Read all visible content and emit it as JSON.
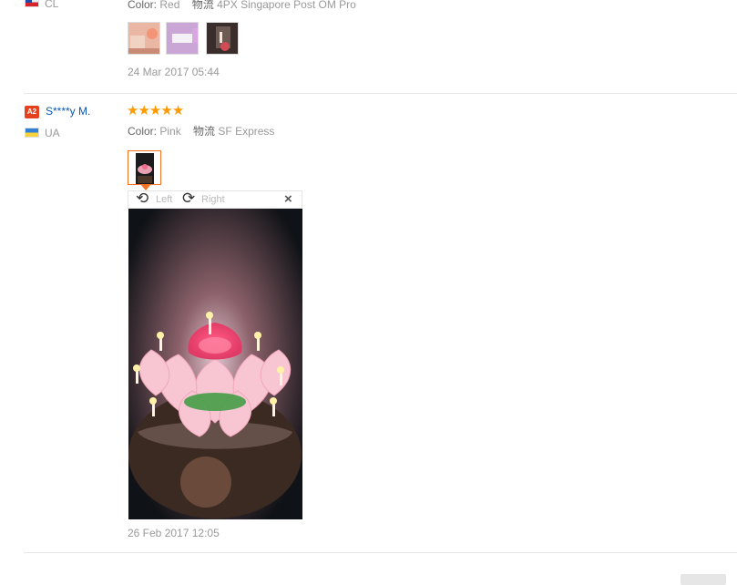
{
  "review_prev": {
    "country": "CL",
    "color_label": "Color:",
    "color_value": "Red",
    "shipping_label": "物流",
    "shipping_value": "4PX Singapore Post OM Pro",
    "date": "24 Mar 2017 05:44",
    "photo_count": 3
  },
  "review_main": {
    "badge": "A2",
    "buyer_name": "S****y M.",
    "country": "UA",
    "rating": 5,
    "color_label": "Color:",
    "color_value": "Pink",
    "shipping_label": "物流",
    "shipping_value": "SF Express",
    "viewer": {
      "rotate_left_label": "Left",
      "rotate_right_label": "Right",
      "close_glyph": "×"
    },
    "date": "26 Feb 2017 12:05"
  },
  "colors": {
    "accent_orange": "#f57224",
    "star": "#ff9a00",
    "link_blue": "#0b58b3"
  }
}
